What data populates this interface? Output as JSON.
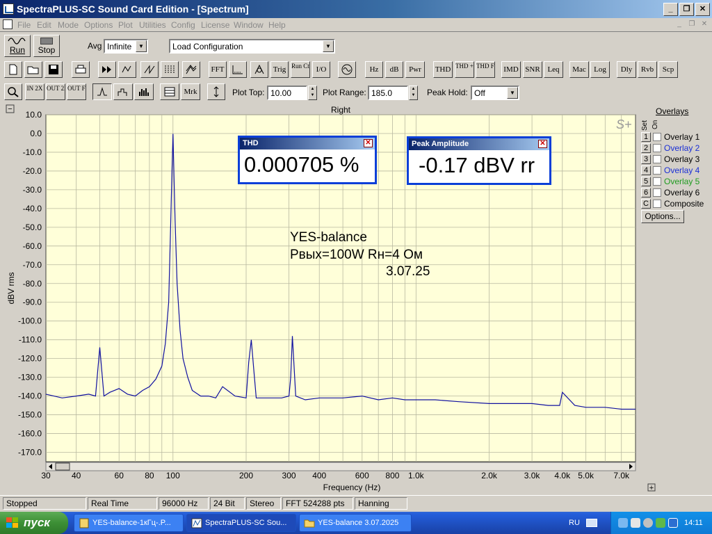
{
  "window": {
    "title": "SpectraPLUS-SC Sound Card Edition - [Spectrum]",
    "controls": [
      "_",
      "❐",
      "✕"
    ]
  },
  "menu": {
    "items": [
      "File",
      "Edit",
      "Mode",
      "Options",
      "Plot",
      "Utilities",
      "Config",
      "License",
      "Window",
      "Help"
    ],
    "mdi_controls": [
      "_",
      "❐",
      "✕"
    ]
  },
  "toolbar1": {
    "run_label": "Run",
    "stop_label": "Stop",
    "avg_label": "Avg",
    "avg_value": "Infinite",
    "config_value": "Load Configuration"
  },
  "toolbar2": {
    "text_buttons": [
      "FFT",
      "Trig",
      "Run Ctrl",
      "I/O",
      "Hz",
      "dB",
      "Pwr",
      "THD",
      "THD +N",
      "THD Freq",
      "IMD",
      "SNR",
      "Leq",
      "Mac",
      "Log",
      "Dly",
      "Rvb",
      "Scp"
    ]
  },
  "toolbar3": {
    "zoom_buttons": [
      "IN 2X",
      "OUT 2X",
      "OUT FULL"
    ],
    "mrk_label": "Mrk",
    "plot_top_label": "Plot Top:",
    "plot_top_value": "10.00",
    "plot_range_label": "Plot Range:",
    "plot_range_value": "185.0",
    "peak_hold_label": "Peak Hold:",
    "peak_hold_value": "Off"
  },
  "plot": {
    "channel_title": "Right",
    "logo": "S+",
    "annotation": [
      "YES-balance",
      "Pвых=100W   Rн=4 Ом",
      "3.07.25"
    ]
  },
  "meters": {
    "thd": {
      "title": "THD",
      "value": "0.000705 %"
    },
    "peak": {
      "title": "Peak Amplitude",
      "value": "-0.17 dBV rr"
    }
  },
  "overlays": {
    "title": "Overlays",
    "header_set": "Set",
    "header_on": "On",
    "items": [
      {
        "num": "1",
        "label": "Overlay 1",
        "color": "#000000"
      },
      {
        "num": "2",
        "label": "Overlay 2",
        "color": "#1a2fd6"
      },
      {
        "num": "3",
        "label": "Overlay 3",
        "color": "#000000"
      },
      {
        "num": "4",
        "label": "Overlay 4",
        "color": "#1a2fd6"
      },
      {
        "num": "5",
        "label": "Overlay 5",
        "color": "#1f9b1f"
      },
      {
        "num": "6",
        "label": "Overlay 6",
        "color": "#000000"
      },
      {
        "num": "C",
        "label": "Composite",
        "color": "#000000"
      }
    ],
    "options_label": "Options..."
  },
  "chart_data": {
    "type": "line",
    "title": "Right",
    "xlabel": "Frequency (Hz)",
    "ylabel": "dBV rms",
    "x_scale": "log",
    "xlim": [
      30,
      8000
    ],
    "ylim": [
      -175,
      10
    ],
    "x_ticks": [
      30,
      40,
      60,
      80,
      100,
      200,
      300,
      400,
      600,
      800,
      1000,
      2000,
      3000,
      4000,
      5000,
      7000
    ],
    "x_tick_labels": [
      "30",
      "40",
      "60",
      "80",
      "100",
      "200",
      "300",
      "400",
      "600",
      "800",
      "1.0k",
      "2.0k",
      "3.0k",
      "4.0k",
      "5.0k",
      "7.0k"
    ],
    "y_ticks": [
      10,
      0,
      -10,
      -20,
      -30,
      -40,
      -50,
      -60,
      -70,
      -80,
      -90,
      -100,
      -110,
      -120,
      -130,
      -140,
      -150,
      -160,
      -170
    ],
    "y_tick_labels": [
      "10.0",
      "0.0",
      "-10.0",
      "-20.0",
      "-30.0",
      "-40.0",
      "-50.0",
      "-60.0",
      "-70.0",
      "-80.0",
      "-90.0",
      "-100.0",
      "-110.0",
      "-120.0",
      "-130.0",
      "-140.0",
      "-150.0",
      "-160.0",
      "-170.0"
    ],
    "grid": true,
    "series": [
      {
        "color": "#1010a0",
        "x": [
          30,
          35,
          40,
          45,
          48,
          50,
          52,
          55,
          60,
          65,
          70,
          75,
          80,
          85,
          90,
          93,
          96,
          98,
          99,
          100,
          101,
          102,
          104,
          107,
          110,
          115,
          120,
          130,
          140,
          150,
          160,
          180,
          200,
          205,
          210,
          215,
          220,
          250,
          280,
          300,
          305,
          310,
          320,
          350,
          400,
          450,
          500,
          600,
          700,
          800,
          900,
          1000,
          1200,
          1500,
          2000,
          2500,
          3000,
          3500,
          3900,
          4000,
          4500,
          5000,
          6000,
          7000,
          8000
        ],
        "y": [
          -139,
          -141,
          -140,
          -139,
          -140,
          -114,
          -140,
          -138,
          -136,
          -139,
          -140,
          -137,
          -135,
          -131,
          -124,
          -112,
          -90,
          -45,
          -22,
          -0.2,
          -24,
          -46,
          -80,
          -105,
          -120,
          -130,
          -137,
          -140,
          -140,
          -141,
          -135,
          -140,
          -141,
          -122,
          -110,
          -126,
          -141,
          -141,
          -141,
          -140,
          -130,
          -108,
          -140,
          -142,
          -141,
          -141,
          -141,
          -140,
          -142,
          -141,
          -142,
          -142,
          -142,
          -143,
          -144,
          -144,
          -144,
          -145,
          -145,
          -138,
          -145,
          -146,
          -146,
          -147,
          -147
        ]
      }
    ]
  },
  "status": {
    "cells": [
      "Stopped",
      "Real Time",
      "96000 Hz",
      "24 Bit",
      "Stereo",
      "FFT 524288 pts",
      "Hanning"
    ]
  },
  "taskbar": {
    "start_label": "пуск",
    "tasks": [
      "YES-balance-1кГц-.P...",
      "SpectraPLUS-SC Sou...",
      "YES-balance  3.07.2025"
    ],
    "lang": "RU",
    "clock": "14:11"
  }
}
